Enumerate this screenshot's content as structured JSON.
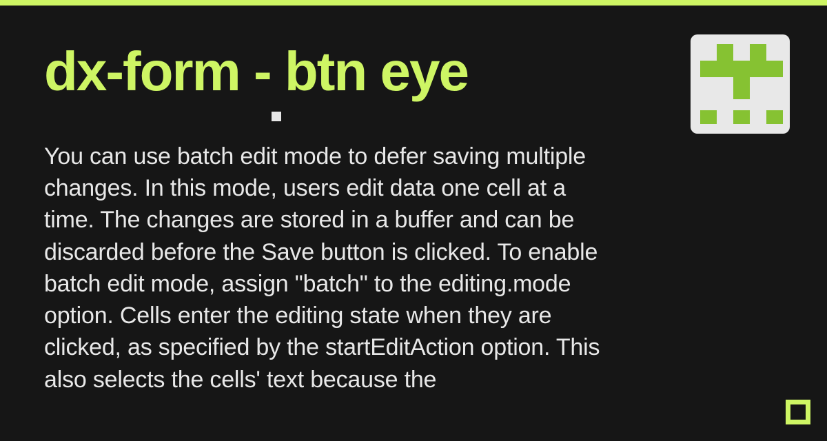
{
  "header": {
    "title": "dx-form - btn eye"
  },
  "body": {
    "text": "You can use batch edit mode to defer saving multiple changes. In this mode, users edit data one cell at a time. The changes are stored in a buffer and can be discarded before the Save button is clicked. To enable batch edit mode, assign \"batch\" to the editing.mode option. Cells enter the editing state when they are clicked, as specified by the startEditAction option. This also selects the cells' text because the"
  }
}
